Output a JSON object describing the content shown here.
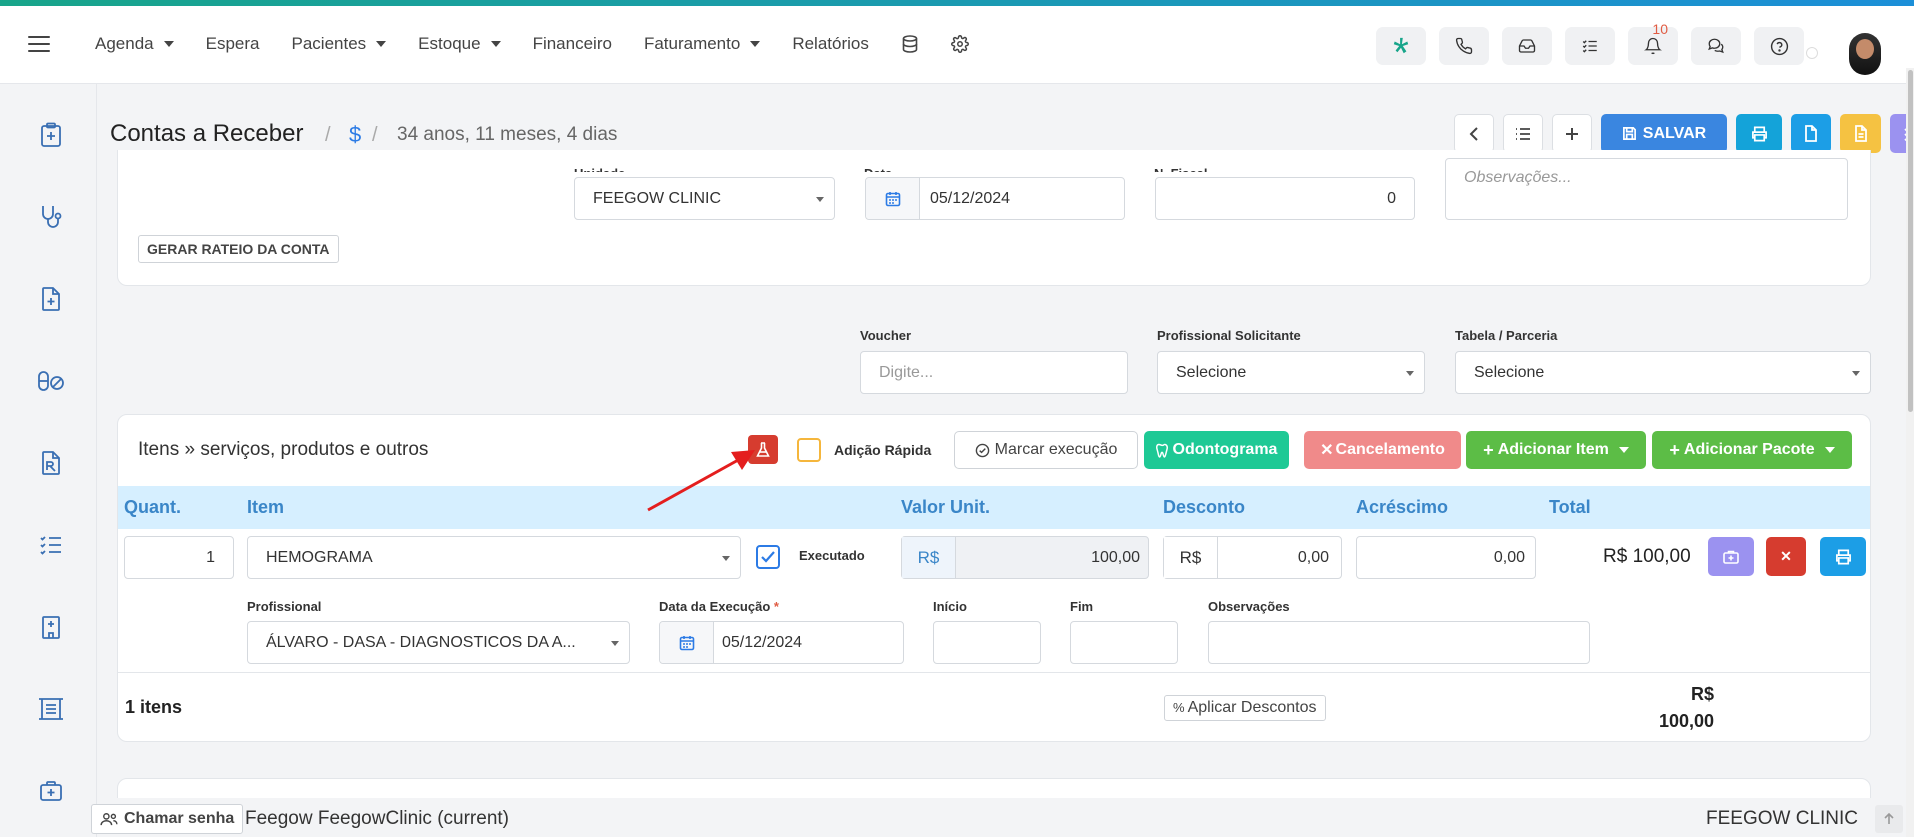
{
  "colors": {
    "accent": "#3a86e0",
    "danger": "#d63c2f",
    "success": "#5cbd46",
    "teal": "#1ec995",
    "annotation": "#e41e1e"
  },
  "nav": {
    "items": [
      {
        "label": "Agenda",
        "dropdown": true
      },
      {
        "label": "Espera",
        "dropdown": false
      },
      {
        "label": "Pacientes",
        "dropdown": true
      },
      {
        "label": "Estoque",
        "dropdown": true
      },
      {
        "label": "Financeiro",
        "dropdown": false
      },
      {
        "label": "Faturamento",
        "dropdown": true
      },
      {
        "label": "Relatórios",
        "dropdown": false
      }
    ],
    "icons": [
      "database-icon",
      "gear-icon"
    ],
    "right_icons": [
      "feegow-logo-icon",
      "phone-icon",
      "inbox-icon",
      "checklist-icon",
      "bell-icon",
      "chat-icon",
      "help-icon"
    ],
    "notification_count": "10"
  },
  "page": {
    "title": "Contas a Receber",
    "currency_symbol": "$",
    "age": "34 anos, 11 meses, 4 dias",
    "save_label": "SALVAR"
  },
  "header_card": {
    "unit_label": "Unidade",
    "unit_value": "FEEGOW CLINIC",
    "date_label": "Data",
    "date_value": "05/12/2024",
    "fiscal_label": "N. Fiscal",
    "fiscal_value": "0",
    "obs_placeholder": "Observações...",
    "rateio_label": "GERAR RATEIO DA CONTA"
  },
  "filters": {
    "voucher_label": "Voucher",
    "voucher_placeholder": "Digite...",
    "prof_label": "Profissional Solicitante",
    "prof_value": "Selecione",
    "table_label": "Tabela / Parceria",
    "table_value": "Selecione"
  },
  "items": {
    "title": "Itens » serviços, produtos e outros",
    "quick_add_label": "Adição Rápida",
    "mark_exec_label": "Marcar execução",
    "odontogram_label": "Odontograma",
    "cancel_label": "Cancelamento",
    "add_item_label": "Adicionar Item",
    "add_package_label": "Adicionar Pacote",
    "columns": [
      "Quant.",
      "Item",
      "Valor Unit.",
      "Desconto",
      "Acréscimo",
      "Total"
    ],
    "row": {
      "qty": "1",
      "item": "HEMOGRAMA",
      "executed_label": "Executado",
      "currency": "R$",
      "unit_value": "100,00",
      "discount_currency": "R$",
      "discount": "0,00",
      "addition": "0,00",
      "total": "R$ 100,00"
    },
    "detail": {
      "prof_label": "Profissional",
      "prof_value": "ÁLVARO - DASA - DIAGNOSTICOS DA A...",
      "exec_date_label": "Data da Execução",
      "exec_date_value": "05/12/2024",
      "start_label": "Início",
      "end_label": "Fim",
      "obs_label": "Observações"
    },
    "count_label": "1 itens",
    "apply_discounts_label": "Aplicar Descontos",
    "sum_currency": "R$",
    "sum_value": "100,00"
  },
  "footer": {
    "call_label": "Chamar senha",
    "company": "Feegow FeegowClinic (current)",
    "unit": "FEEGOW CLINIC"
  }
}
